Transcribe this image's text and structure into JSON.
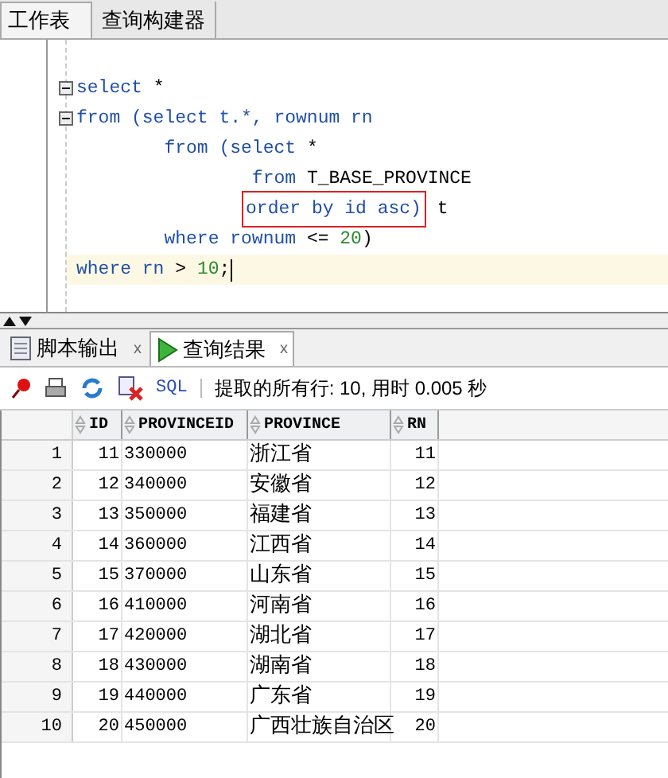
{
  "top_tabs": [
    {
      "label": "工作表",
      "selected": true
    },
    {
      "label": "查询构建器",
      "selected": false
    }
  ],
  "editor": {
    "lines": [
      {
        "fold": true,
        "current": false,
        "segments": [
          {
            "kind": "keyword",
            "text": "select "
          },
          {
            "kind": "plain",
            "text": "*"
          }
        ]
      },
      {
        "fold": true,
        "current": false,
        "segments": [
          {
            "kind": "keyword",
            "text": "from (select t.*, rownum rn"
          }
        ]
      },
      {
        "fold": false,
        "current": false,
        "segments": [
          {
            "kind": "keyword",
            "text": "        from (select "
          },
          {
            "kind": "plain",
            "text": "*"
          }
        ]
      },
      {
        "fold": false,
        "current": false,
        "segments": [
          {
            "kind": "keyword",
            "text": "                from "
          },
          {
            "kind": "plain",
            "text": "T_BASE_PROVINCE"
          }
        ]
      },
      {
        "fold": false,
        "current": false,
        "segments": [
          {
            "kind": "boxed",
            "text": "               order by id asc)"
          },
          {
            "kind": "plain",
            "text": " t"
          }
        ]
      },
      {
        "fold": false,
        "current": false,
        "segments": [
          {
            "kind": "keyword",
            "text": "        where rownum "
          },
          {
            "kind": "plain",
            "text": "<= "
          },
          {
            "kind": "number",
            "text": "20"
          },
          {
            "kind": "plain",
            "text": ")"
          }
        ]
      },
      {
        "fold": false,
        "current": true,
        "segments": [
          {
            "kind": "keyword",
            "text": "where rn "
          },
          {
            "kind": "plain",
            "text": "> "
          },
          {
            "kind": "number",
            "text": "10"
          },
          {
            "kind": "plain",
            "text": ";"
          }
        ]
      }
    ]
  },
  "bottom_tabs": [
    {
      "label": "脚本输出",
      "close": "x",
      "selected": false
    },
    {
      "label": "查询结果",
      "close": "x",
      "selected": true
    }
  ],
  "toolbar": {
    "sql": "SQL",
    "status": "提取的所有行: 10, 用时 0.005 秒"
  },
  "table": {
    "columns": [
      "",
      "ID",
      "PROVINCEID",
      "PROVINCE",
      "RN"
    ],
    "rows": [
      [
        "1",
        "11",
        "330000",
        "浙江省",
        "11"
      ],
      [
        "2",
        "12",
        "340000",
        "安徽省",
        "12"
      ],
      [
        "3",
        "13",
        "350000",
        "福建省",
        "13"
      ],
      [
        "4",
        "14",
        "360000",
        "江西省",
        "14"
      ],
      [
        "5",
        "15",
        "370000",
        "山东省",
        "15"
      ],
      [
        "6",
        "16",
        "410000",
        "河南省",
        "16"
      ],
      [
        "7",
        "17",
        "420000",
        "湖北省",
        "17"
      ],
      [
        "8",
        "18",
        "430000",
        "湖南省",
        "18"
      ],
      [
        "9",
        "19",
        "440000",
        "广东省",
        "19"
      ],
      [
        "10",
        "20",
        "450000",
        "广西壮族自治区",
        "20"
      ]
    ]
  }
}
